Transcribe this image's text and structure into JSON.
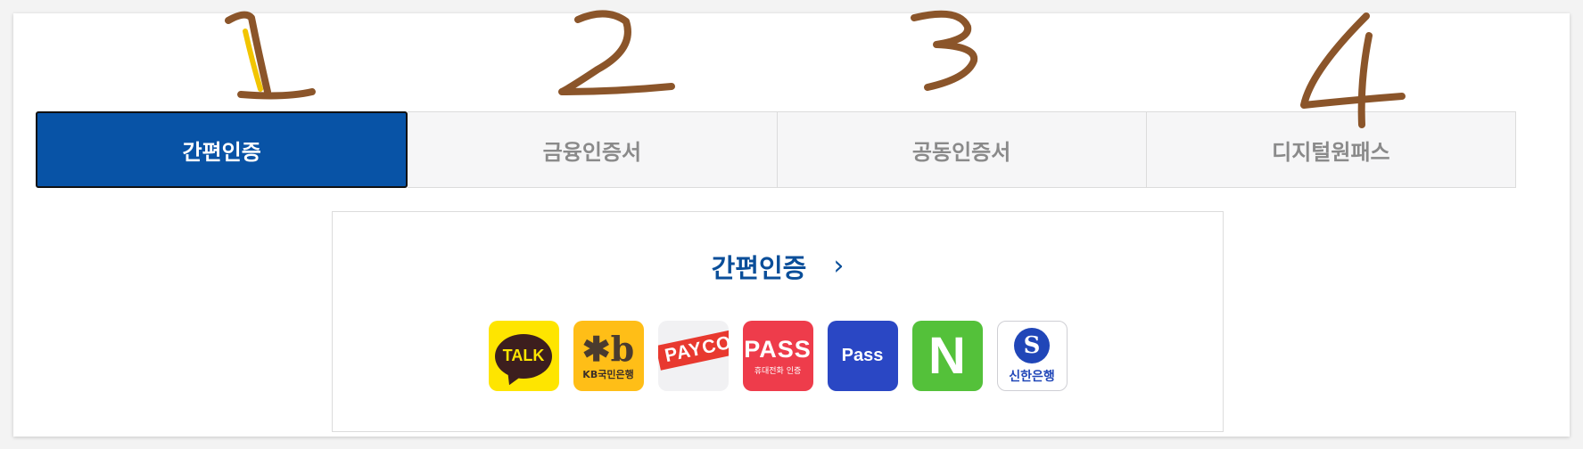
{
  "tabs": [
    {
      "label": "간편인증",
      "active": true
    },
    {
      "label": "금융인증서",
      "active": false
    },
    {
      "label": "공동인증서",
      "active": false
    },
    {
      "label": "디지털원패스",
      "active": false
    }
  ],
  "panel": {
    "title": "간편인증",
    "chevron": "›",
    "apps": [
      {
        "name": "kakaotalk",
        "text": "TALK",
        "color": "#fee500"
      },
      {
        "name": "kb-bank",
        "mark": "✱b",
        "text": "KB국민은행",
        "color": "#ffbe17"
      },
      {
        "name": "payco",
        "text": "PAYCO",
        "color": "#e8392f"
      },
      {
        "name": "pass-red",
        "text": "PASS",
        "subtext": "휴대전화 인증",
        "color": "#ee3c4b"
      },
      {
        "name": "pass-blue",
        "text": "Pass",
        "color": "#2a47c4"
      },
      {
        "name": "naver",
        "text": "N",
        "color": "#54c13a"
      },
      {
        "name": "shinhan",
        "mark": "S",
        "text": "신한은행",
        "color": "#2046b8"
      }
    ]
  },
  "annotations": [
    "1",
    "2",
    "3",
    "4"
  ],
  "colors": {
    "accent": "#0853a6",
    "handwriting": "#8b552a"
  }
}
